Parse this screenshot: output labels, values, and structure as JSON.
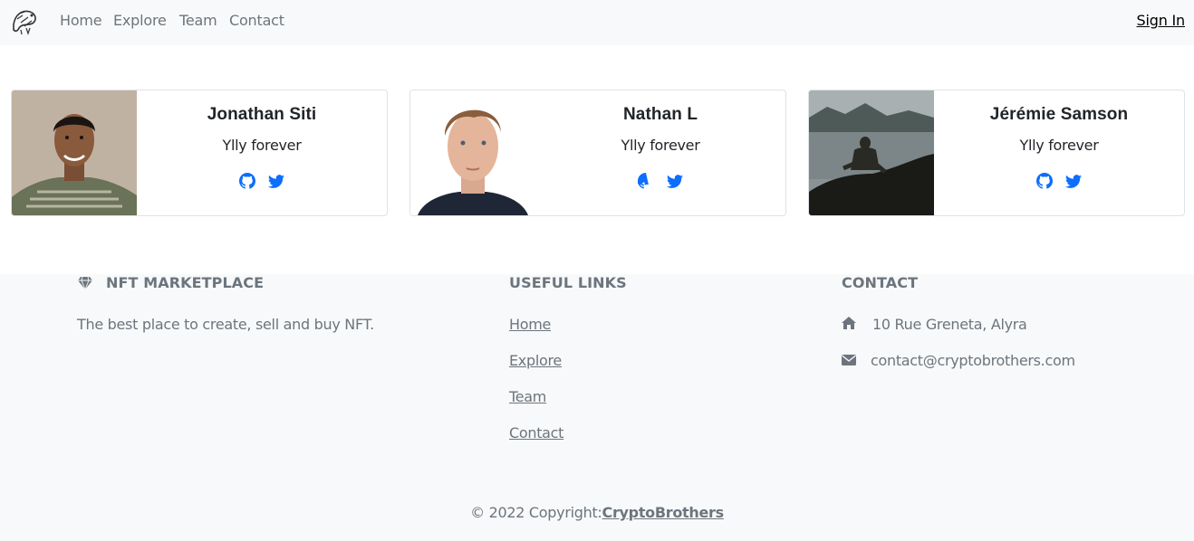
{
  "navbar": {
    "links": [
      "Home",
      "Explore",
      "Team",
      "Contact"
    ],
    "signin_label": "Sign In"
  },
  "team": [
    {
      "name": "Jonathan Siti",
      "tagline": "Ylly forever"
    },
    {
      "name": "Nathan L",
      "tagline": "Ylly forever"
    },
    {
      "name": "Jérémie Samson",
      "tagline": "Ylly forever"
    }
  ],
  "footer": {
    "brand": {
      "title": "NFT MARKETPLACE",
      "description": "The best place to create, sell and buy NFT."
    },
    "useful_links": {
      "title": "USEFUL LINKS",
      "links": [
        "Home",
        "Explore",
        "Team",
        "Contact"
      ]
    },
    "contact": {
      "title": "CONTACT",
      "address": "10 Rue Greneta, Alyra",
      "email": "contact@cryptobrothers.com"
    },
    "copyright_prefix": "© 2022 Copyright:",
    "copyright_brand": "CryptoBrothers"
  },
  "colors": {
    "navbar_bg": "#f8f9fa",
    "muted_text": "#6c757d",
    "icon_blue": "#0d6efd",
    "card_border": "#dee2e6"
  },
  "icons": {
    "logo": "brand-logo",
    "brand": "gem-icon",
    "social": [
      "github-icon",
      "twitter-icon"
    ],
    "address": "home-icon",
    "email": "envelope-icon"
  }
}
